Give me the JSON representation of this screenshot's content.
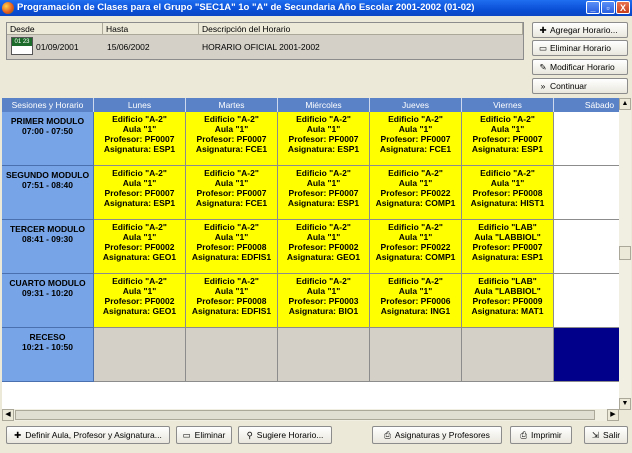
{
  "window": {
    "title": "Programación de Clases para el Grupo \"SEC1A\" 1o \"A\" de Secundaria Año Escolar 2001-2002 (01-02)",
    "controls": [
      "_",
      "▫",
      "X"
    ]
  },
  "periods": {
    "headers": [
      "Desde",
      "Hasta",
      "Descripción del Horario"
    ],
    "row": {
      "icon_text": "01 23",
      "desde": "01/09/2001",
      "hasta": "15/06/2002",
      "descripcion": "HORARIO OFICIAL 2001-2002"
    }
  },
  "side_buttons": [
    {
      "label": "Agregar Horario...",
      "icon": "add-icon",
      "glyph": "✚"
    },
    {
      "label": "Eliminar Horario",
      "icon": "remove-icon",
      "glyph": "▭"
    },
    {
      "label": "Modificar Horario",
      "icon": "pencil-icon",
      "glyph": "✎"
    },
    {
      "label": "Continuar",
      "icon": "forward-icon",
      "glyph": "»"
    }
  ],
  "schedule": {
    "corner_header": "Sesiones y Horario",
    "days": [
      "Lunes",
      "Martes",
      "Miércoles",
      "Jueves",
      "Viernes",
      "Sábado"
    ],
    "sessions": [
      {
        "name": "PRIMER MODULO",
        "time": "07:00 - 07:50",
        "cells": [
          [
            "Edificio \"A-2\"",
            "Aula \"1\"",
            "Profesor: PF0007",
            "Asignatura: ESP1"
          ],
          [
            "Edificio \"A-2\"",
            "Aula \"1\"",
            "Profesor: PF0007",
            "Asignatura: FCE1"
          ],
          [
            "Edificio \"A-2\"",
            "Aula \"1\"",
            "Profesor: PF0007",
            "Asignatura: ESP1"
          ],
          [
            "Edificio \"A-2\"",
            "Aula \"1\"",
            "Profesor: PF0007",
            "Asignatura: FCE1"
          ],
          [
            "Edificio \"A-2\"",
            "Aula \"1\"",
            "Profesor: PF0007",
            "Asignatura: ESP1"
          ]
        ]
      },
      {
        "name": "SEGUNDO MODULO",
        "time": "07:51 - 08:40",
        "cells": [
          [
            "Edificio \"A-2\"",
            "Aula \"1\"",
            "Profesor: PF0007",
            "Asignatura: ESP1"
          ],
          [
            "Edificio \"A-2\"",
            "Aula \"1\"",
            "Profesor: PF0007",
            "Asignatura: FCE1"
          ],
          [
            "Edificio \"A-2\"",
            "Aula \"1\"",
            "Profesor: PF0007",
            "Asignatura: ESP1"
          ],
          [
            "Edificio \"A-2\"",
            "Aula \"1\"",
            "Profesor: PF0022",
            "Asignatura: COMP1"
          ],
          [
            "Edificio \"A-2\"",
            "Aula \"1\"",
            "Profesor: PF0008",
            "Asignatura: HIST1"
          ]
        ]
      },
      {
        "name": "TERCER MODULO",
        "time": "08:41 - 09:30",
        "cells": [
          [
            "Edificio \"A-2\"",
            "Aula \"1\"",
            "Profesor: PF0002",
            "Asignatura: GEO1"
          ],
          [
            "Edificio \"A-2\"",
            "Aula \"1\"",
            "Profesor: PF0008",
            "Asignatura: EDFIS1"
          ],
          [
            "Edificio \"A-2\"",
            "Aula \"1\"",
            "Profesor: PF0002",
            "Asignatura: GEO1"
          ],
          [
            "Edificio \"A-2\"",
            "Aula \"1\"",
            "Profesor: PF0022",
            "Asignatura: COMP1"
          ],
          [
            "Edificio \"LAB\"",
            "Aula \"LABBIOL\"",
            "Profesor: PF0007",
            "Asignatura: ESP1"
          ]
        ]
      },
      {
        "name": "CUARTO MODULO",
        "time": "09:31 - 10:20",
        "cells": [
          [
            "Edificio \"A-2\"",
            "Aula \"1\"",
            "Profesor: PF0002",
            "Asignatura: GEO1"
          ],
          [
            "Edificio \"A-2\"",
            "Aula \"1\"",
            "Profesor: PF0008",
            "Asignatura: EDFIS1"
          ],
          [
            "Edificio \"A-2\"",
            "Aula \"1\"",
            "Profesor: PF0003",
            "Asignatura: BIO1"
          ],
          [
            "Edificio \"A-2\"",
            "Aula \"1\"",
            "Profesor: PF0006",
            "Asignatura: ING1"
          ],
          [
            "Edificio \"LAB\"",
            "Aula \"LABBIOL\"",
            "Profesor: PF0009",
            "Asignatura: MAT1"
          ]
        ]
      },
      {
        "name": "RECESO",
        "time": "10:21 - 10:50",
        "cells": []
      }
    ]
  },
  "bottom_buttons": [
    {
      "label": "Definir Aula, Profesor y Asignatura...",
      "icon": "add-icon",
      "glyph": "✚"
    },
    {
      "label": "Eliminar",
      "icon": "remove-icon",
      "glyph": "▭"
    },
    {
      "label": "Sugiere Horario...",
      "icon": "wand-icon",
      "glyph": "⚲"
    },
    {
      "label": "Asignaturas y Profesores",
      "icon": "printer-icon",
      "glyph": "⎙"
    },
    {
      "label": "Imprimir",
      "icon": "printer-icon",
      "glyph": "⎙"
    },
    {
      "label": "Salir",
      "icon": "exit-icon",
      "glyph": "⇲"
    }
  ],
  "colors": {
    "accent": "#0a4fd6",
    "cell": "#ffff00",
    "row_header": "#76a4e6",
    "selected": "#00008b"
  }
}
